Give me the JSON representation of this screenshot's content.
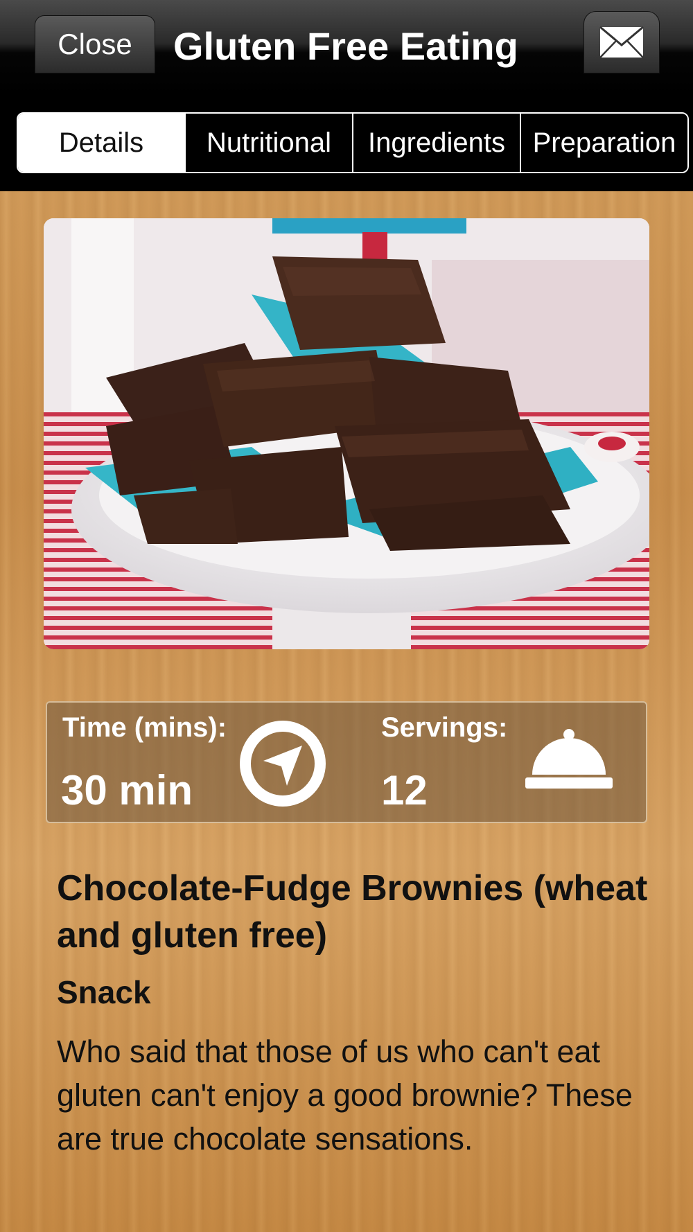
{
  "header": {
    "close_label": "Close",
    "title": "Gluten Free Eating",
    "mail_icon": "envelope-icon"
  },
  "tabs": [
    {
      "label": "Details",
      "active": true
    },
    {
      "label": "Nutritional",
      "active": false
    },
    {
      "label": "Ingredients",
      "active": false
    },
    {
      "label": "Preparation",
      "active": false
    }
  ],
  "stats": {
    "time_label": "Time (mins):",
    "time_value": "30 min",
    "time_icon": "location-arrow-icon",
    "servings_label": "Servings:",
    "servings_value": "12",
    "servings_icon": "serving-cloche-icon"
  },
  "recipe": {
    "title": "Chocolate-Fudge Brownies (wheat and gluten free)",
    "category": "Snack",
    "description": "Who said that those of us who can't eat gluten can't enjoy a good brownie? These are true chocolate sensations."
  },
  "colors": {
    "navbar": "#000000",
    "wood": "#d2995a",
    "brownie": "#3b2119",
    "napkin": "#35b6c8"
  }
}
